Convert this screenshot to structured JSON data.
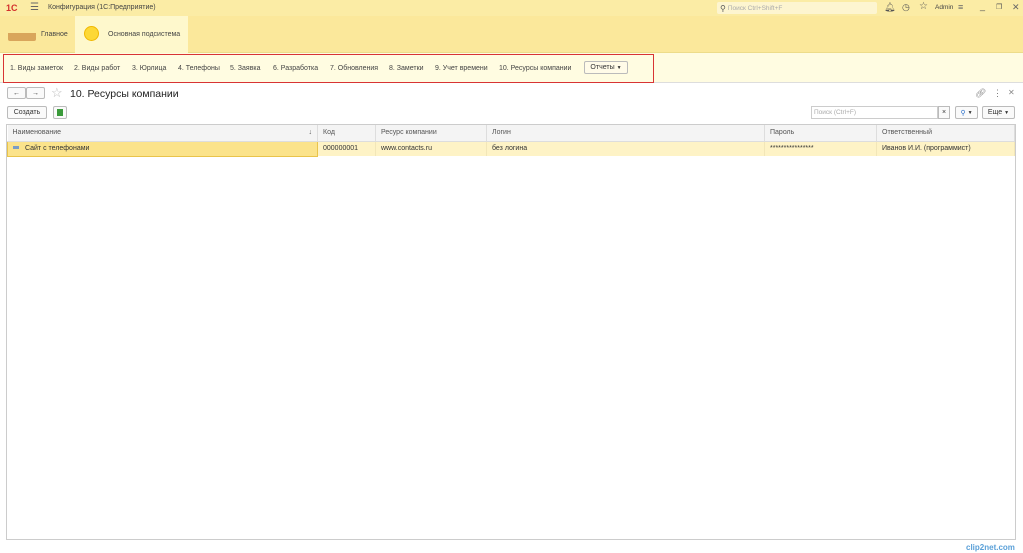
{
  "app": {
    "title": "Конфигурация  (1С:Предприятие)",
    "search_placeholder": "Поиск Ctrl+Shift+F",
    "user": "Admin"
  },
  "sections": [
    {
      "label": "Главное"
    },
    {
      "label": "Основная подсистема"
    }
  ],
  "nav": {
    "items": [
      "1. Виды заметок",
      "2. Виды работ",
      "3. Юрлица",
      "4. Телефоны",
      "5. Заявка",
      "6. Разработка",
      "7. Обновления",
      "8. Заметки",
      "9. Учет времени",
      "10. Ресурсы компании"
    ],
    "reports_label": "Отчеты"
  },
  "form": {
    "title": "10. Ресурсы компании",
    "create_label": "Создать",
    "search_placeholder": "Поиск (Ctrl+F)",
    "more_label": "Еще"
  },
  "table": {
    "columns": [
      "Наименование",
      "Код",
      "Ресурс компании",
      "Логин",
      "Пароль",
      "Ответственный"
    ],
    "rows": [
      {
        "name": "Сайт с телефонами",
        "code": "000000001",
        "resource": "www.contacts.ru",
        "login": "без логина",
        "password": "****************",
        "responsible": "Иванов И.И. (программист)"
      }
    ]
  },
  "watermark": "clip2net.com"
}
